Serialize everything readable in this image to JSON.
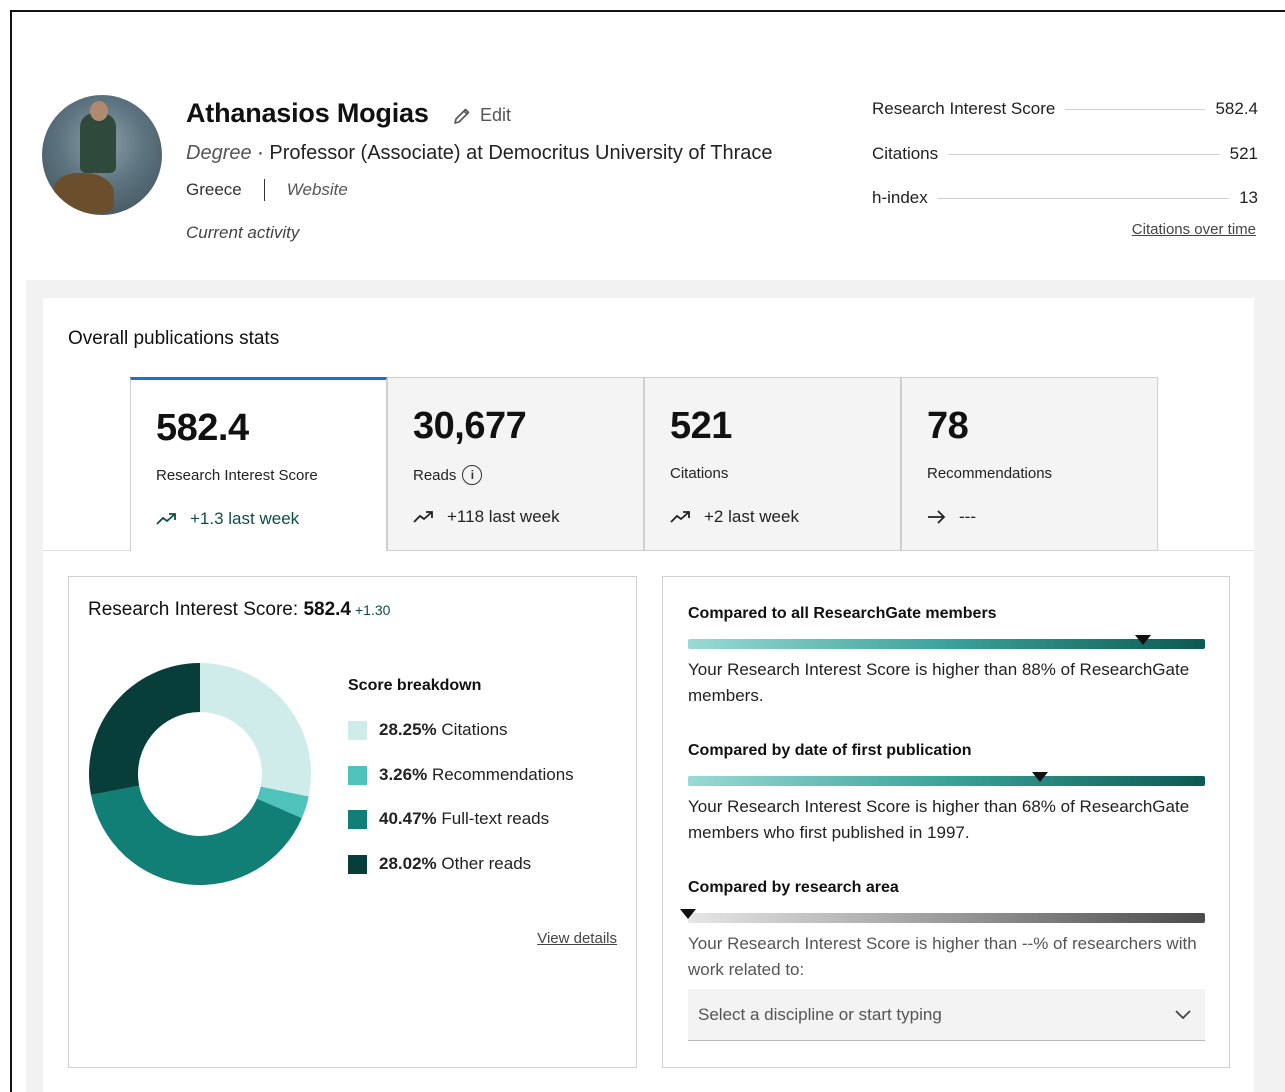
{
  "profile": {
    "name": "Athanasios Mogias",
    "edit_label": "Edit",
    "degree_label": "Degree",
    "degree_separator": " · ",
    "position": "Professor (Associate) at Democritus University of Thrace",
    "country": "Greece",
    "website_label": "Website",
    "current_activity": "Current activity"
  },
  "metrics": {
    "items": [
      {
        "label": "Research Interest Score",
        "value": "582.4"
      },
      {
        "label": "Citations",
        "value": "521"
      },
      {
        "label": "h-index",
        "value": "13"
      }
    ],
    "citations_over_time": "Citations over time"
  },
  "stats": {
    "title": "Overall publications stats",
    "tabs": [
      {
        "value": "582.4",
        "label": "Research Interest Score",
        "trend": "+1.3 last week",
        "trend_icon": "trend-up-icon"
      },
      {
        "value": "30,677",
        "label": "Reads",
        "trend": "+118 last week",
        "trend_icon": "trend-up-icon",
        "info": "i"
      },
      {
        "value": "521",
        "label": "Citations",
        "trend": "+2 last week",
        "trend_icon": "trend-up-icon"
      },
      {
        "value": "78",
        "label": "Recommendations",
        "trend": "---",
        "trend_icon": "arrow-right-icon"
      }
    ]
  },
  "ris": {
    "title_prefix": "Research Interest Score: ",
    "value": "582.4",
    "delta": "+1.30",
    "breakdown_title": "Score breakdown",
    "view_details": "View details"
  },
  "chart_data": {
    "type": "pie",
    "categories": [
      "Citations",
      "Recommendations",
      "Full-text reads",
      "Other reads"
    ],
    "values": [
      28.25,
      3.26,
      40.47,
      28.02
    ],
    "pct_labels": [
      "28.25%",
      "3.26%",
      "40.47%",
      "28.02%"
    ],
    "colors": [
      "#cfeceb",
      "#4fc2bb",
      "#117f76",
      "#073e3a"
    ],
    "title": "Score breakdown"
  },
  "compare": {
    "sections": [
      {
        "title": "Compared to all ResearchGate members",
        "text": "Your Research Interest Score is higher than 88% of ResearchGate members.",
        "percentile": 0.88
      },
      {
        "title": "Compared by date of first publication",
        "text": "Your Research Interest Score is higher than 68% of ResearchGate members who first published in 1997.",
        "percentile": 0.68
      },
      {
        "title": "Compared by research area",
        "text": "Your Research Interest Score is higher than --% of researchers with work related to:",
        "percentile": 0.0
      }
    ],
    "select_placeholder": "Select a discipline or start typing"
  }
}
